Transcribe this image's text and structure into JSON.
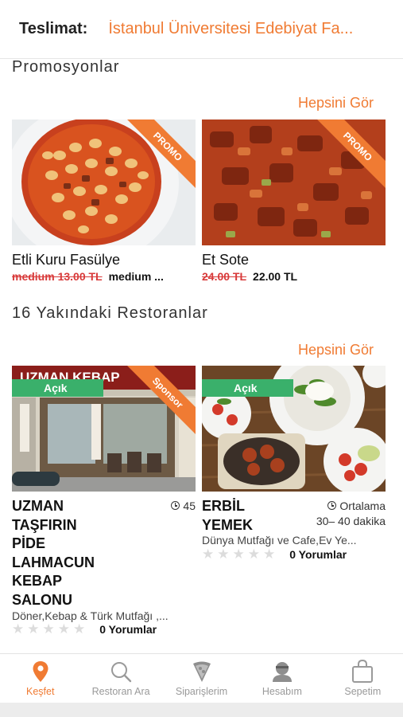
{
  "header": {
    "delivery_label": "Teslimat:",
    "address": "İstanbul Üniversitesi Edebiyat Fa..."
  },
  "promotions": {
    "title": "Promosyonlar",
    "see_all": "Hepsini Gör",
    "items": [
      {
        "name": "Etli Kuru Fasülye",
        "old_price": "medium 13.00 TL",
        "new_price": "medium ...",
        "ribbon": "PROMO"
      },
      {
        "name": "Et Sote",
        "old_price": "24.00 TL",
        "new_price": "22.00 TL",
        "ribbon": "PROMO"
      }
    ]
  },
  "nearby": {
    "title": "16 Yakındaki Restoranlar",
    "see_all": "Hepsini Gör",
    "restaurants": [
      {
        "status": "Açık",
        "ribbon": "Sponsor",
        "name_lines": [
          "UZMAN",
          "TAŞFIRIN",
          "PİDE",
          "LAHMACUN",
          "KEBAP",
          "SALONU"
        ],
        "eta": "45",
        "cuisine": "Döner,Kebap & Türk Mutfağı ,...",
        "reviews": "0 Yorumlar",
        "rating": 0,
        "sign_text": "UZMAN KEBAP"
      },
      {
        "status": "Açık",
        "name_lines": [
          "ERBİL",
          "YEMEK"
        ],
        "eta_lines": [
          "Ortalama",
          "30– 40 dakika"
        ],
        "cuisine": "Dünya Mutfağı ve Cafe,Ev Ye...",
        "reviews": "0 Yorumlar",
        "rating": 0
      }
    ]
  },
  "tabbar": {
    "items": [
      {
        "label": "Keşfet",
        "icon": "map-pin-icon",
        "active": true
      },
      {
        "label": "Restoran Ara",
        "icon": "search-icon",
        "active": false
      },
      {
        "label": "Siparişlerim",
        "icon": "pizza-slice-icon",
        "active": false
      },
      {
        "label": "Hesabım",
        "icon": "user-icon",
        "active": false
      },
      {
        "label": "Sepetim",
        "icon": "shopping-bag-icon",
        "active": false
      }
    ]
  },
  "colors": {
    "accent": "#f07b33",
    "open_badge": "#3ab06b",
    "old_price": "#d83a3a"
  }
}
